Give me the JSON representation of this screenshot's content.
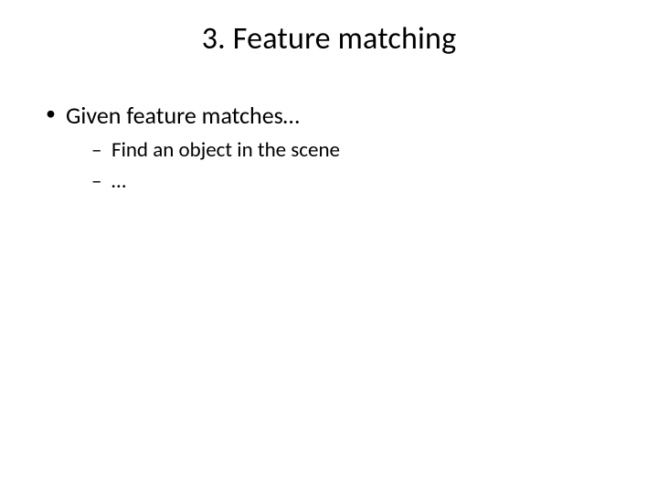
{
  "slide": {
    "title": "3. Feature matching",
    "bullets": [
      {
        "text": "Given feature matches…",
        "subitems": [
          "Find an object in the scene",
          "…"
        ]
      }
    ]
  }
}
